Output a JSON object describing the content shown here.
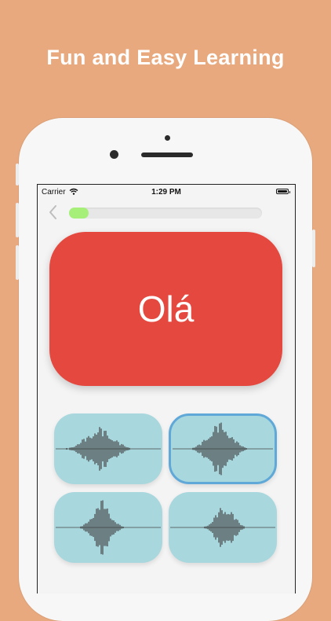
{
  "headline": "Fun and Easy Learning",
  "status_bar": {
    "carrier": "Carrier",
    "time": "1:29 PM"
  },
  "progress": {
    "fraction": 0.1
  },
  "card": {
    "word": "Olá",
    "color": "#E4483E"
  },
  "options": [
    {
      "name": "audio-option-1",
      "selected": false
    },
    {
      "name": "audio-option-2",
      "selected": true
    },
    {
      "name": "audio-option-3",
      "selected": false
    },
    {
      "name": "audio-option-4",
      "selected": false
    }
  ],
  "colors": {
    "background": "#E8A97E",
    "option": "#A9D7DE",
    "option_selected_border": "#5FA8D8",
    "progress": "#A6F07A"
  }
}
